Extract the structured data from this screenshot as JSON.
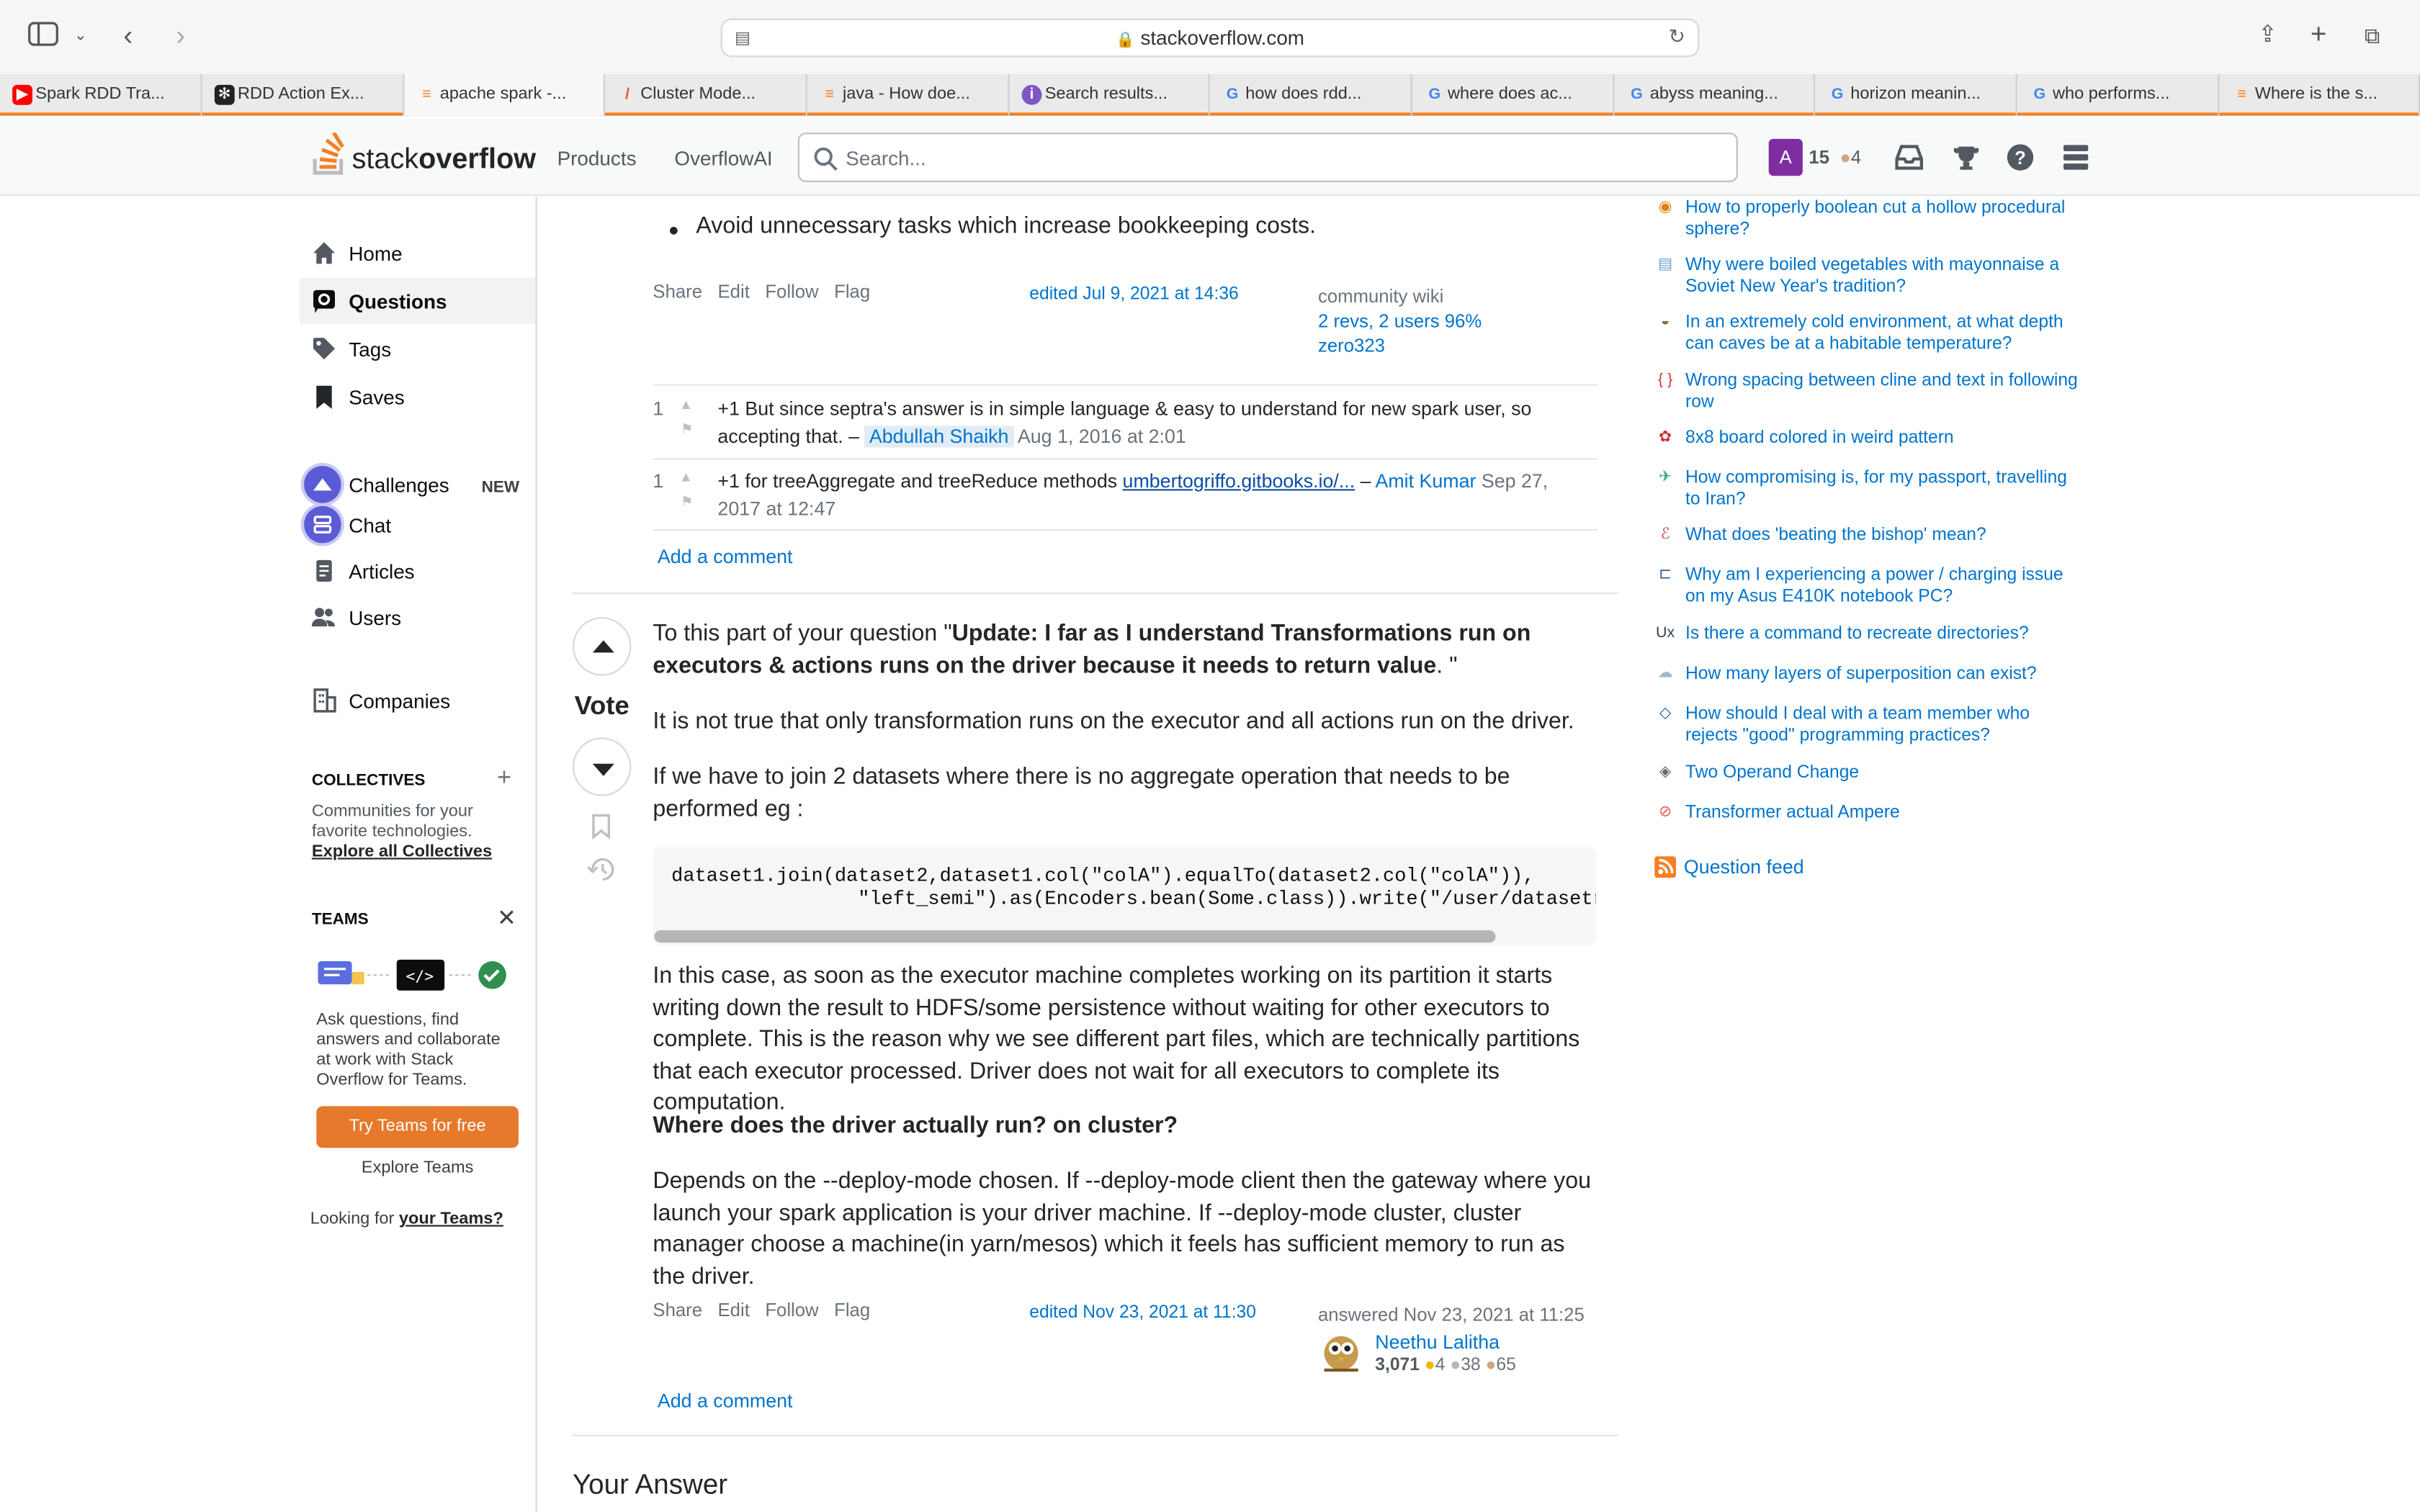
{
  "browser": {
    "url": "stackoverflow.com",
    "tabs": [
      {
        "title": "Spark RDD Tra...",
        "icon": "youtube-icon"
      },
      {
        "title": "RDD Action Ex...",
        "icon": "openai-icon"
      },
      {
        "title": "apache spark -...",
        "icon": "stackoverflow-icon"
      },
      {
        "title": "Cluster Mode...",
        "icon": "spark-icon"
      },
      {
        "title": "java - How doe...",
        "icon": "stackoverflow-icon"
      },
      {
        "title": "Search results...",
        "icon": "search-icon"
      },
      {
        "title": "how does rdd...",
        "icon": "google-icon"
      },
      {
        "title": "where does ac...",
        "icon": "google-icon"
      },
      {
        "title": "abyss meaning...",
        "icon": "google-icon"
      },
      {
        "title": "horizon meanin...",
        "icon": "google-icon"
      },
      {
        "title": "who performs...",
        "icon": "google-icon"
      },
      {
        "title": "Where is the s...",
        "icon": "stackoverflow-icon"
      }
    ]
  },
  "header": {
    "logo_light": "stack",
    "logo_bold": "overflow",
    "nav": [
      "Products",
      "OverflowAI"
    ],
    "search_placeholder": "Search...",
    "avatar_letter": "A",
    "reputation": "15",
    "bronze": "4"
  },
  "sidebar": {
    "items": [
      "Home",
      "Questions",
      "Tags",
      "Saves"
    ],
    "items2": [
      "Challenges",
      "Chat",
      "Articles",
      "Users"
    ],
    "new_badge": "NEW",
    "companies": "Companies",
    "collectives_title": "COLLECTIVES",
    "collectives_text_1": "Communities for your",
    "collectives_text_2": "favorite technologies.",
    "collectives_link": "Explore all Collectives",
    "teams_title": "TEAMS",
    "teams_text": [
      "Ask questions, find",
      "answers and collaborate",
      "at work with Stack",
      "Overflow for Teams."
    ],
    "teams_button": "Try Teams for free",
    "explore_teams": "Explore Teams",
    "looking_for": "Looking for ",
    "your_teams": "your Teams?"
  },
  "answer1": {
    "bullet": "Avoid unnecessary tasks which increase bookkeeping costs.",
    "actions": [
      "Share",
      "Edit",
      "Follow",
      "Flag"
    ],
    "edited": "edited Jul 9, 2021 at 14:36",
    "wiki": "community wiki",
    "revs": "2 revs, 2 users 96%",
    "user": "zero323",
    "comments": [
      {
        "score": "1",
        "text": "+1 But since septra's answer is in simple language & easy to understand for new spark user, so accepting that. – ",
        "user": "Abdullah Shaikh",
        "date": "Aug 1, 2016 at 2:01"
      },
      {
        "score": "1",
        "text": "+1 for treeAggregate and treeReduce methods ",
        "link": "umbertogriffo.gitbooks.io/...",
        "sep": " – ",
        "user": "Amit Kumar",
        "date": "Sep 27, 2017 at 12:47"
      }
    ],
    "add_comment": "Add a comment"
  },
  "answer2": {
    "vote_label": "Vote",
    "intro": "To this part of your question \"",
    "intro_bold": "Update: I far as I understand Transformations run on executors & actions runs on the driver because it needs to return value",
    "intro_end": ". \"",
    "p1": "It is not true that only transformation runs on the executor and all actions run on the driver.",
    "p2": "If we have to join 2 datasets where there is no aggregate operation that needs to be performed eg :",
    "code": "dataset1.join(dataset2,dataset1.col(\"colA\").equalTo(dataset2.col(\"colA\")),\n                \"left_semi\").as(Encoders.bean(Some.class)).write(\"/user/datasetr",
    "p3": "In this case, as soon as the executor machine completes working on its partition it starts writing down the result to HDFS/some persistence without waiting for other executors to complete. This is the reason why we see different part files, which are technically partitions that each executor processed. Driver does not wait for all executors to complete its computation.",
    "h": "Where does the driver actually run? on cluster?",
    "p4": "Depends on the --deploy-mode chosen. If --deploy-mode client then the gateway where you launch your spark application is your driver machine. If --deploy-mode cluster, cluster manager choose a machine(in yarn/mesos) which it feels has sufficient memory to run as the driver.",
    "actions": [
      "Share",
      "Edit",
      "Follow",
      "Flag"
    ],
    "edited": "edited Nov 23, 2021 at 11:30",
    "answered": "answered Nov 23, 2021 at 11:25",
    "user": "Neethu Lalitha",
    "rep": "3,071",
    "gold": "4",
    "silver": "38",
    "bronze": "65",
    "add_comment": "Add a comment"
  },
  "your_answer": "Your Answer",
  "hot_questions": [
    {
      "title": "How to properly boolean cut a hollow procedural sphere?",
      "icon": "blender-icon",
      "color": "#e87d0d"
    },
    {
      "title": "Why were boiled vegetables with mayonnaise a Soviet New Year's tradition?",
      "icon": "history-icon",
      "color": "#6aa1d4"
    },
    {
      "title": "In an extremely cold environment, at what depth can caves be at a habitable temperature?",
      "icon": "worldbuilding-icon",
      "color": "#8a6b3a"
    },
    {
      "title": "Wrong spacing between cline and text in following row",
      "icon": "tex-icon",
      "color": "#d33"
    },
    {
      "title": "8x8 board colored in weird pattern",
      "icon": "puzzling-icon",
      "color": "#c33"
    },
    {
      "title": "How compromising is, for my passport, travelling to Iran?",
      "icon": "travel-icon",
      "color": "#3a7"
    },
    {
      "title": "What does 'beating the bishop' mean?",
      "icon": "english-icon",
      "color": "#c44"
    },
    {
      "title": "Why am I experiencing a power / charging issue on my Asus E410K notebook PC?",
      "icon": "superuser-icon",
      "color": "#2d5f9a"
    },
    {
      "title": "Is there a command to recreate directories?",
      "icon": "unix-icon",
      "color": "#345"
    },
    {
      "title": "How many layers of superposition can exist?",
      "icon": "quantum-icon",
      "color": "#9bc"
    },
    {
      "title": "How should I deal with a team member who rejects \"good\" programming practices?",
      "icon": "workplace-icon",
      "color": "#2060c0"
    },
    {
      "title": "Two Operand Change",
      "icon": "codegolf-icon",
      "color": "#666"
    },
    {
      "title": "Transformer actual Ampere",
      "icon": "electronics-icon",
      "color": "#e55"
    }
  ],
  "question_feed": "Question feed"
}
